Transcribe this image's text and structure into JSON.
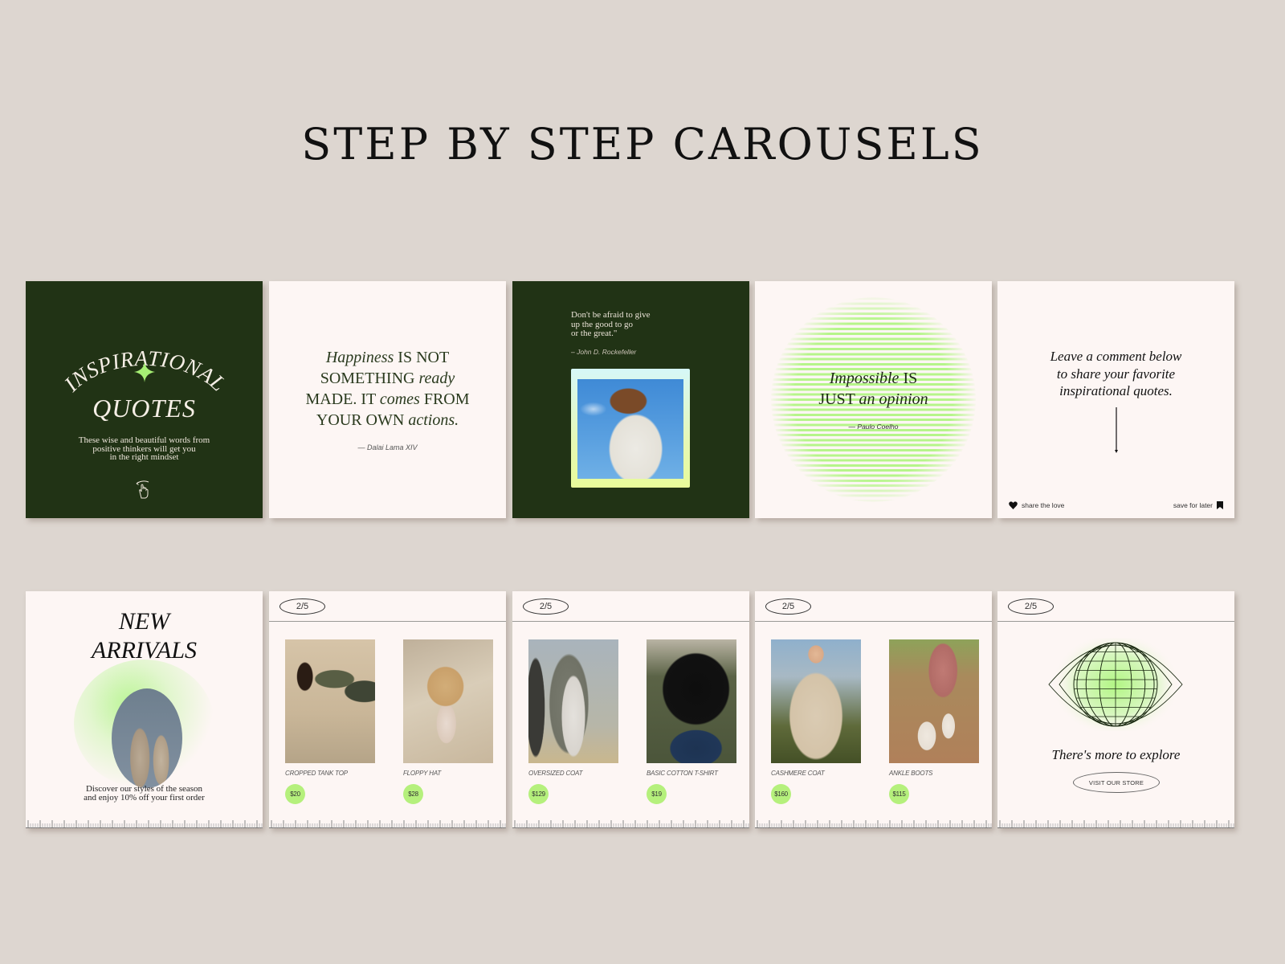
{
  "page": {
    "title": "STEP BY STEP CAROUSELS",
    "background_color": "#ddd6d0",
    "accent_green": "#b5f07c",
    "dark_green": "#213315",
    "card_background": "#fdf6f4"
  },
  "row1": {
    "card1": {
      "arc_title": "INSPIRATIONAL",
      "title_second": "QUOTES",
      "description_lines": [
        "These wise and beautiful words from",
        "positive thinkers will get you",
        "in the right mindset"
      ],
      "icon": "swipe-hand-icon",
      "sparkle_icon": "sparkle-icon"
    },
    "card2": {
      "quote_lines": [
        [
          {
            "t": "Happiness",
            "i": true
          },
          {
            "t": " IS NOT",
            "i": false
          }
        ],
        [
          {
            "t": "SOMETHING ",
            "i": false
          },
          {
            "t": "ready",
            "i": true
          }
        ],
        [
          {
            "t": "MADE. IT ",
            "i": false
          },
          {
            "t": "comes",
            "i": true
          },
          {
            "t": " FROM",
            "i": false
          }
        ],
        [
          {
            "t": "YOUR OWN ",
            "i": false
          },
          {
            "t": "actions.",
            "i": true
          }
        ]
      ],
      "author": "— Dalai Lama XIV"
    },
    "card3": {
      "quote_lines": [
        "Don't be afraid to give",
        "up the good to go",
        "or the great.\""
      ],
      "author": "– John D. Rockefeller",
      "image": "woman-in-white-suit-sky-photo"
    },
    "card4": {
      "quote_lines": [
        [
          {
            "t": "Impossible",
            "i": true
          },
          {
            "t": " IS",
            "i": false
          }
        ],
        [
          {
            "t": "JUST ",
            "i": false
          },
          {
            "t": "an opinion",
            "i": true
          }
        ]
      ],
      "author": "— Paulo Coelho"
    },
    "card5": {
      "text_lines": [
        "Leave a comment below",
        "to share your favorite",
        "inspirational quotes."
      ],
      "share_label": "share the love",
      "save_label": "save for later"
    }
  },
  "row2": {
    "card6": {
      "title_lines": [
        "NEW",
        "ARRIVALS"
      ],
      "description_lines": [
        "Discover our styles of the season",
        "and enjoy 10% off your first order"
      ],
      "image": "two-models-in-trench-coats-photo"
    },
    "card7": {
      "page_indicator": "2/5",
      "products": [
        {
          "name": "CROPPED TANK TOP",
          "price": "$20",
          "photo": "ph-tank"
        },
        {
          "name": "FLOPPY HAT",
          "price": "$28",
          "photo": "ph-hat"
        }
      ]
    },
    "card8": {
      "page_indicator": "2/5",
      "products": [
        {
          "name": "OVERSIZED COAT",
          "price": "$129",
          "photo": "ph-coat"
        },
        {
          "name": "BASIC COTTON T-SHIRT",
          "price": "$19",
          "photo": "ph-tee"
        }
      ]
    },
    "card9": {
      "page_indicator": "2/5",
      "products": [
        {
          "name": "CASHMERE COAT",
          "price": "$160",
          "photo": "ph-cashmere"
        },
        {
          "name": "ANKLE BOOTS",
          "price": "$115",
          "photo": "ph-boots"
        }
      ]
    },
    "card10": {
      "page_indicator": "2/5",
      "text": "There's more to explore",
      "button_label": "VISIT OUR STORE",
      "icon": "globe-eye-icon"
    }
  }
}
